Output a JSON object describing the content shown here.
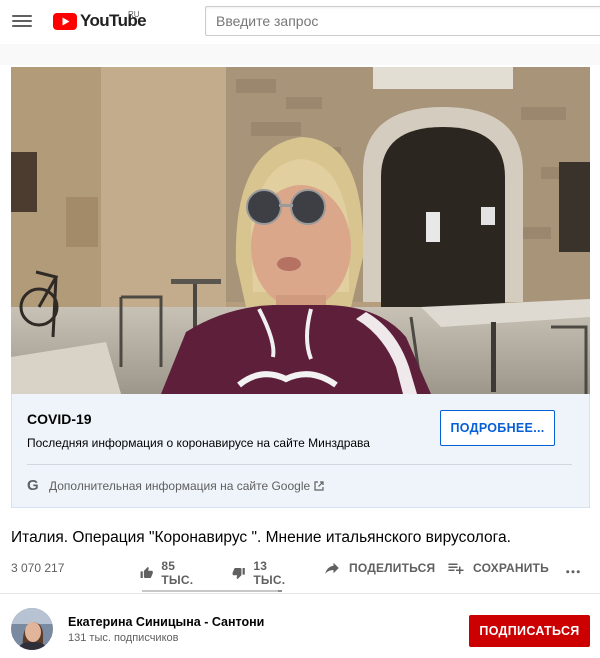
{
  "header": {
    "logo_text": "YouTube",
    "region": "RU",
    "search_placeholder": "Введите запрос"
  },
  "info_panel": {
    "title": "COVID-19",
    "description": "Последняя информация о коронавирусе на сайте Минздрава",
    "button_label": "ПОДРОБНЕЕ...",
    "more_link": "Дополнительная информация на сайте Google"
  },
  "video": {
    "title": "Италия. Операция \"Коронавирус \". Мнение итальянского вирусолога.",
    "views": "3 070 217",
    "sentiment_ratio": 0.97
  },
  "actions": {
    "like": "85 ТЫС.",
    "dislike": "13 ТЫС.",
    "share": "ПОДЕЛИТЬСЯ",
    "save": "СОХРАНИТЬ"
  },
  "channel": {
    "name": "Екатерина Синицына - Сантони",
    "subscribers": "131 тыс. подписчиков",
    "subscribe_label": "ПОДПИСАТЬСЯ"
  },
  "colors": {
    "brand_red": "#ff0000",
    "subscribe_red": "#cc0000",
    "link_blue": "#065fd4",
    "panel_bg": "#eef4fa"
  }
}
